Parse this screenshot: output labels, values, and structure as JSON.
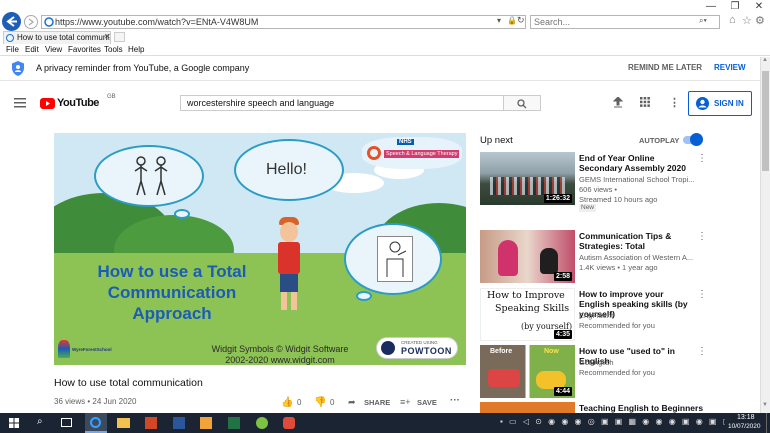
{
  "browser": {
    "url": "https://www.youtube.com/watch?v=ENtA-V4W8UM",
    "search_placeholder": "Search...",
    "tab_title": "How to use total communi...",
    "menu": [
      "File",
      "Edit",
      "View",
      "Favorites",
      "Tools",
      "Help"
    ]
  },
  "privacy": {
    "text": "A privacy reminder from YouTube, a Google company",
    "remind": "REMIND ME LATER",
    "review": "REVIEW"
  },
  "header": {
    "logo": "YouTube",
    "country": "GB",
    "search_value": "worcestershire speech and language",
    "signin": "SIGN IN"
  },
  "video": {
    "hello": "Hello!",
    "nhs": "NHS",
    "service": "Speech & Language Therapy",
    "main_text": [
      "How to use a Total",
      "Communication",
      "Approach"
    ],
    "credit_1": "Widgit Symbols © Widgit Software",
    "credit_2": "2002-2020 www.widgit.com",
    "created_using": "CREATED USING",
    "powtoon": "POWTOON",
    "school": "WyreForestSchool",
    "title": "How to use total communication",
    "meta": "36 views • 24 Jun 2020",
    "likes": "0",
    "dislikes": "0",
    "share": "SHARE",
    "save": "SAVE"
  },
  "upnext": {
    "label": "Up next",
    "autoplay": "AUTOPLAY",
    "items": [
      {
        "title": "End of Year Online Secondary Assembly 2020",
        "channel": "GEMS International School Tropi...",
        "views": "606 views •",
        "extra": "Streamed 10 hours ago",
        "badge": "New",
        "duration": "1:26:32"
      },
      {
        "title": "Communication Tips & Strategies: Total",
        "channel": "Autism Association of Western A...",
        "views": "1.4K views • 1 year ago",
        "duration": "2:58"
      },
      {
        "title": "How to improve your English speaking skills (by yourself)",
        "channel": "EngFluent",
        "views": "Recommended for you",
        "duration": "4:35",
        "thumb_text_1": "How to Improve",
        "thumb_text_2": "Speaking Skills",
        "thumb_text_3": "(by yourself)"
      },
      {
        "title": "How to use \"used to\" in English",
        "channel": "GoEnglish",
        "views": "Recommended for you",
        "duration": "4:44",
        "thumb_before": "Before",
        "thumb_now": "Now"
      },
      {
        "title": "Teaching English to Beginners"
      }
    ]
  },
  "taskbar": {
    "time": "13:18",
    "date": "10/07/2020"
  }
}
